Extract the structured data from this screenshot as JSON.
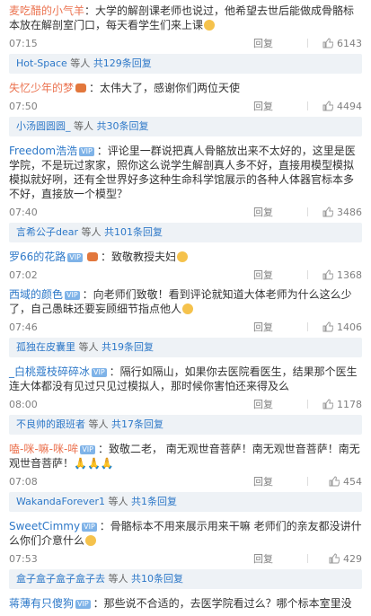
{
  "comments": [
    {
      "user": "麦吃醋的小气羊",
      "text": "：大学的解剖课老师也说过，他希望去世后能做成骨骼标本放在解剖室门口，每天看学生们来上课",
      "time": "07:15",
      "reply_label": "回复",
      "likes": "6143",
      "has_emoji": true
    },
    {
      "user": "失忆少年的梦",
      "text": "：太伟大了，感谢你们两位天使",
      "time": "07:50",
      "reply_label": "回复",
      "likes": "4494"
    },
    {
      "user": "Freedom浩浩",
      "text": "：评论里一群说把真人骨骼放出来不太好的，这里是医学院，不是玩过家家，照你这么说学生解剖真人多不好，直接用模型模拟模拟就好咧，还有全世界好多这种生命科学馆展示的各种人体器官标本多不好，直接放一个模型？",
      "time": "07:40",
      "reply_label": "回复",
      "likes": "3486"
    },
    {
      "user": "罗66的花路",
      "text": "：致敬教授夫妇",
      "time": "07:02",
      "reply_label": "回复",
      "likes": "1368"
    },
    {
      "user": "西域的颜色",
      "text": "：向老师们致敬！看到评论就知道大体老师为什么这么少了，自己愚昧还要妄顾细节指点他人",
      "time": "07:46",
      "reply_label": "回复",
      "likes": "1406"
    },
    {
      "user": "_白桃蔻枝碎碎冰",
      "text": "：隔行如隔山，如果你去医院看医生，结果那个医生连大体都没有见过只见过模拟人，那时候你害怕还来得及么",
      "time": "08:00",
      "reply_label": "回复",
      "likes": "1178"
    },
    {
      "user": "嗑-咪-嘛-咪-哞",
      "text": "：致敬二老，  南无观世音菩萨！南无观世音菩萨！南无观世音菩萨！",
      "time": "07:08",
      "reply_label": "回复",
      "likes": "454"
    },
    {
      "user": "SweetCimmy",
      "text": "：骨骼标本不用来展示用来干嘛 老师们的亲友都没讲什么你们介意什么",
      "time": "07:53",
      "reply_label": "回复",
      "likes": "429"
    },
    {
      "user": "蒋薄有只傻狗",
      "text": "：那些说不合适的，去医学院看过么？哪个标本室里没",
      "time": "",
      "reply_label": "",
      "likes": ""
    }
  ],
  "reply_bars": [
    {
      "name": "Hot-Space",
      "suffix": " 等人 ",
      "count": "共129条回复"
    },
    {
      "name": "小汤圆圆圆_",
      "suffix": " 等人 ",
      "count": "共30条回复"
    },
    {
      "name": "言希公子dear",
      "suffix": " 等人 ",
      "count": "共101条回复"
    },
    {
      "name": "孤独在皮囊里",
      "suffix": " 等人 ",
      "count": "共19条回复"
    },
    {
      "name": "不良帅的跟班者",
      "suffix": " 等人 ",
      "count": "共17条回复"
    },
    {
      "name": "WakandaForever1",
      "suffix": " 等人 ",
      "count": "共1条回复"
    },
    {
      "name": "盒子盒子盒子盒子去",
      "suffix": " 等人 ",
      "count": "共10条回复"
    }
  ],
  "badge_vip": "VIP",
  "colors": {
    "username": "#eb7350",
    "link": "#2d78c8",
    "reply_bg": "#eef2f6"
  },
  "icons": {
    "like": "thumb-up-icon",
    "medal": "medal-icon",
    "emoji": "smile-emoji-icon"
  }
}
